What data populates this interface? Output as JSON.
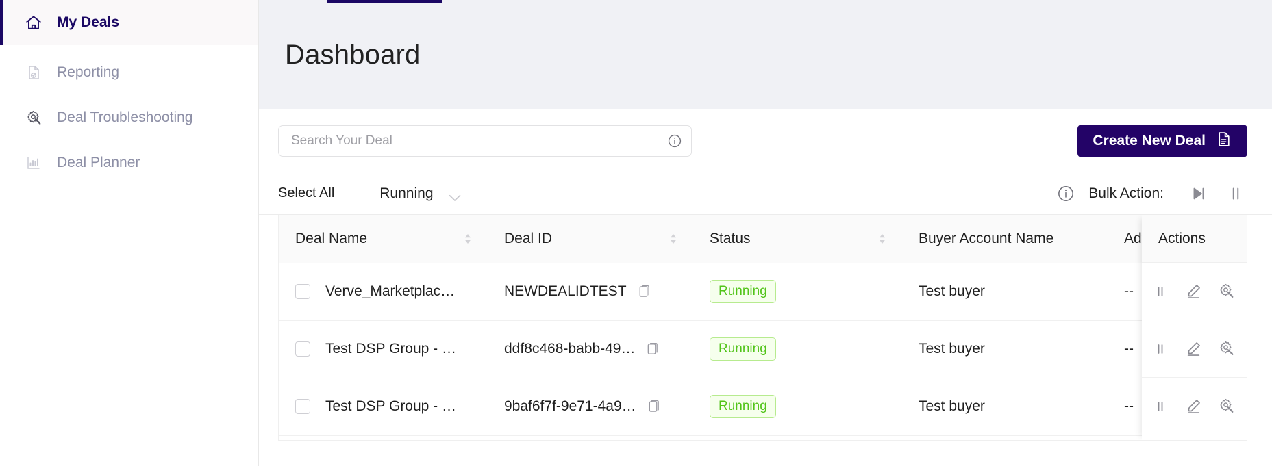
{
  "sidebar": {
    "items": [
      {
        "label": "My Deals",
        "icon": "home-icon",
        "active": true
      },
      {
        "label": "Reporting",
        "icon": "report-icon",
        "active": false
      },
      {
        "label": "Deal Troubleshooting",
        "icon": "troubleshoot-icon",
        "active": false
      },
      {
        "label": "Deal Planner",
        "icon": "chart-bar-icon",
        "active": false
      }
    ]
  },
  "header": {
    "title": "Dashboard"
  },
  "search": {
    "placeholder": "Search Your Deal",
    "value": "",
    "info_icon": "info-icon"
  },
  "toolbar": {
    "create_label": "Create New Deal",
    "create_icon": "document-icon"
  },
  "filters": {
    "select_all": "Select All",
    "status_value": "Running",
    "chevron_icon": "chevron-down-icon",
    "bulk_info_icon": "info-icon",
    "bulk_label": "Bulk Action:",
    "bulk_play_icon": "play-skip-icon",
    "bulk_pause_icon": "pause-icon"
  },
  "table": {
    "columns": [
      {
        "label": "Deal Name",
        "sortable": true
      },
      {
        "label": "Deal ID",
        "sortable": true
      },
      {
        "label": "Status",
        "sortable": true
      },
      {
        "label": "Buyer Account Name",
        "sortable": true
      },
      {
        "label": "Advertis",
        "sortable": false
      },
      {
        "label": "Actions",
        "sortable": false
      }
    ],
    "rows": [
      {
        "deal_name": "Verve_Marketplac…",
        "deal_id": "NEWDEALIDTEST",
        "status": "Running",
        "buyer": "Test buyer",
        "advertiser": "--"
      },
      {
        "deal_name": "Test DSP Group - …",
        "deal_id": "ddf8c468-babb-49…",
        "status": "Running",
        "buyer": "Test buyer",
        "advertiser": "--"
      },
      {
        "deal_name": "Test DSP Group - …",
        "deal_id": "9baf6f7f-9e71-4a9…",
        "status": "Running",
        "buyer": "Test buyer",
        "advertiser": "--"
      }
    ],
    "row_actions": {
      "pause_icon": "pause-icon",
      "edit_icon": "pencil-icon",
      "troubleshoot_icon": "troubleshoot-icon"
    },
    "copy_icon": "copy-icon"
  },
  "colors": {
    "brand": "#230367",
    "sidebar_active_text": "#1b0864",
    "status_green": "#52c41a",
    "status_green_bg": "#f6ffed",
    "header_bg": "#f0f1f5"
  }
}
